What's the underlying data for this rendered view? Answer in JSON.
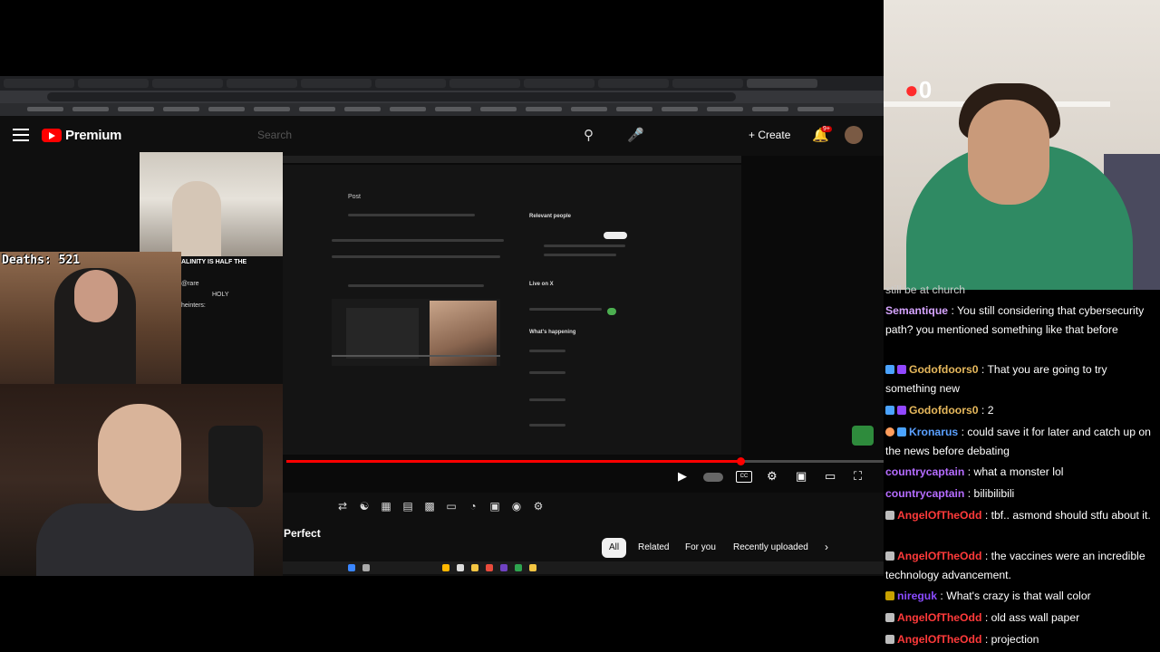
{
  "browser": {
    "yt_brand": "Premium",
    "search_placeholder": "Search",
    "create_label": "Create",
    "notifications_count": "9+",
    "icons": {
      "menu": "hamburger-icon",
      "search": "search-icon",
      "mic": "mic-icon",
      "create": "plus-icon",
      "bell": "bell-icon"
    }
  },
  "video": {
    "x_post_header": "Post",
    "relevant_people": "Relevant people",
    "live_on_x": "Live on X",
    "whats_happening": "What's happening",
    "progress": 0.76
  },
  "below_player": {
    "title_fragment": "Perfect",
    "chips": [
      "All",
      "Related",
      "For you",
      "Recently uploaded"
    ]
  },
  "overlay": {
    "deaths_label": "Deaths: 521",
    "streamer_logo_text": "0",
    "mini_chat": [
      "ALINITY IS HALF THE",
      "@rare",
      "HOLY",
      "heinters:"
    ]
  },
  "chat": {
    "colors": {
      "Semantique": "#d6a4ff",
      "Godofdoors0": "#e6b85c",
      "Kronarus": "#5aa0ff",
      "countrycaptain": "#b56cff",
      "AngelOfTheOdd": "#ff3a3a",
      "nireguk": "#8a4bff"
    },
    "messages": [
      {
        "user": "",
        "text": "still be at church"
      },
      {
        "user": "Semantique",
        "text": "You still considering that cybersecurity path? you mentioned something like that before"
      },
      {
        "user": "Godofdoors0",
        "text": "That you are going to try something new"
      },
      {
        "user": "Godofdoors0",
        "text": "2"
      },
      {
        "user": "Kronarus",
        "text": "could save it for later and catch up on the news before debating"
      },
      {
        "user": "countrycaptain",
        "text": "what a monster lol"
      },
      {
        "user": "countrycaptain",
        "text": "bilibilibili"
      },
      {
        "user": "AngelOfTheOdd",
        "text": "tbf.. asmond should stfu about it."
      },
      {
        "user": "AngelOfTheOdd",
        "text": "the vaccines were an incredible technology advancement."
      },
      {
        "user": "nireguk",
        "text": "What's crazy is that wall color"
      },
      {
        "user": "AngelOfTheOdd",
        "text": "old ass wall paper"
      },
      {
        "user": "AngelOfTheOdd",
        "text": "projection"
      }
    ]
  }
}
